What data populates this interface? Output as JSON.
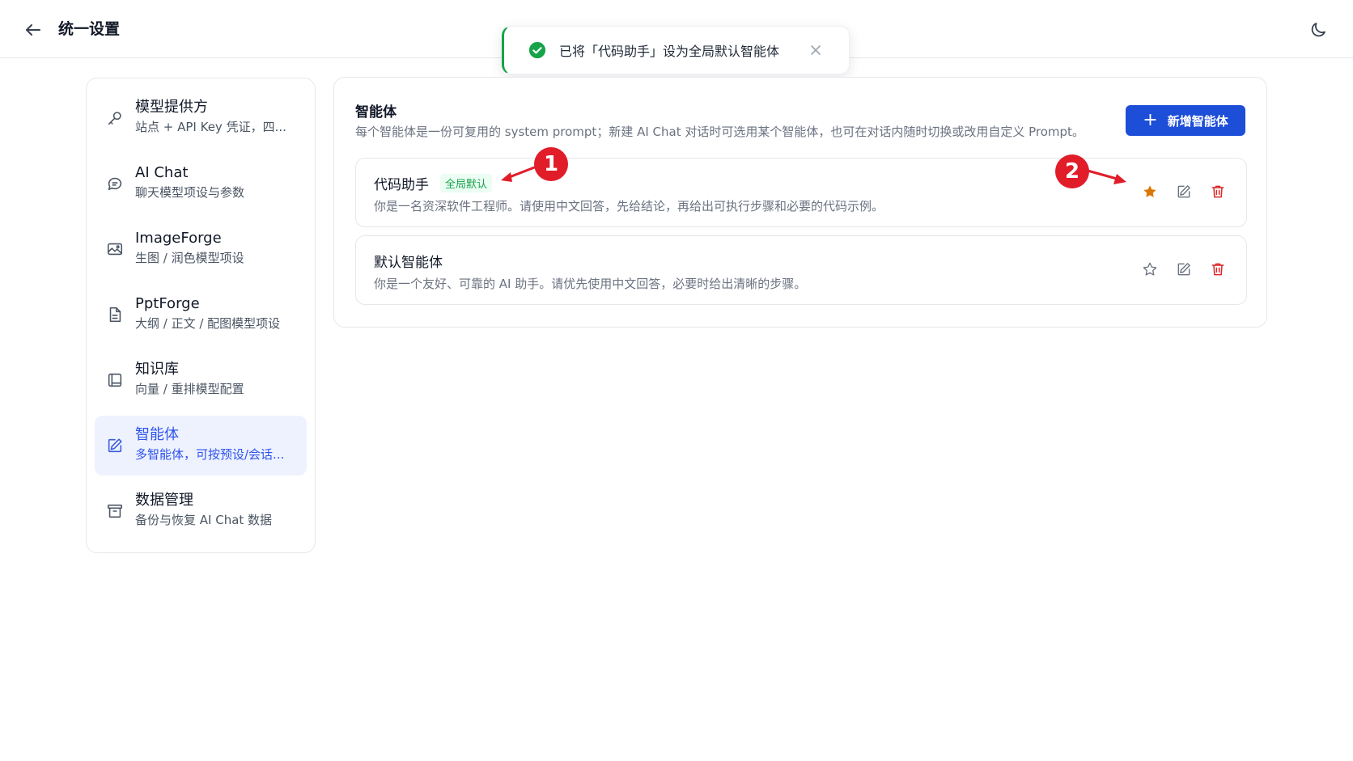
{
  "header": {
    "title": "统一设置",
    "back_icon": "arrow-left-icon",
    "theme_icon": "moon-icon"
  },
  "toast": {
    "message": "已将「代码助手」设为全局默认智能体",
    "status_color": "#16a34a"
  },
  "sidebar": {
    "items": [
      {
        "title": "模型提供方",
        "subtitle": "站点 + API Key 凭证，四...",
        "icon": "key-icon"
      },
      {
        "title": "AI Chat",
        "subtitle": "聊天模型项设与参数",
        "icon": "chat-icon"
      },
      {
        "title": "ImageForge",
        "subtitle": "生图 / 润色模型项设",
        "icon": "image-icon"
      },
      {
        "title": "PptForge",
        "subtitle": "大纲 / 正文 / 配图模型项设",
        "icon": "document-icon"
      },
      {
        "title": "知识库",
        "subtitle": "向量 / 重排模型配置",
        "icon": "book-icon"
      },
      {
        "title": "智能体",
        "subtitle": "多智能体，可按预设/会话...",
        "icon": "edit-icon",
        "active": true
      },
      {
        "title": "数据管理",
        "subtitle": "备份与恢复 AI Chat 数据",
        "icon": "archive-icon"
      }
    ]
  },
  "main": {
    "title": "智能体",
    "description": "每个智能体是一份可复用的 system prompt；新建 AI Chat 对话时可选用某个智能体，也可在对话内随时切换或改用自定义 Prompt。",
    "add_button": "新增智能体",
    "agents": [
      {
        "name": "代码助手",
        "badge": "全局默认",
        "prompt": "你是一名资深软件工程师。请使用中文回答，先给结论，再给出可执行步骤和必要的代码示例。",
        "is_default": true
      },
      {
        "name": "默认智能体",
        "badge": "",
        "prompt": "你是一个友好、可靠的 AI 助手。请优先使用中文回答，必要时给出清晰的步骤。",
        "is_default": false
      }
    ]
  },
  "annotations": {
    "one": "1",
    "two": "2",
    "color": "#e11d2a"
  },
  "colors": {
    "accent": "#1d4ed8",
    "star_active": "#d97706",
    "delete": "#dc2626"
  }
}
